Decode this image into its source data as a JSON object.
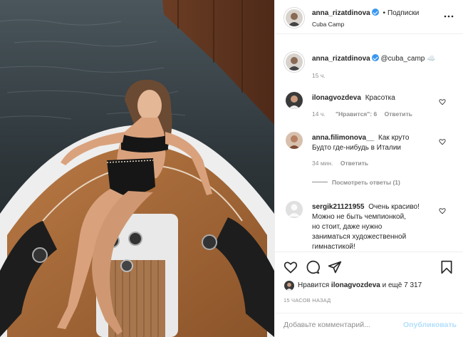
{
  "header": {
    "username": "anna_rizatdinova",
    "separator": "•",
    "follow_label": "Подписки",
    "location": "Cuba Camp",
    "more_icon": "more-horizontal-icon"
  },
  "caption": {
    "username": "anna_rizatdinova",
    "text": "@cuba_camp ☁️",
    "time": "15 ч."
  },
  "comments": [
    {
      "username": "ilonagvozdeva",
      "text": "Красотка",
      "time": "14 ч.",
      "likes": "\"Нравится\": 6",
      "reply": "Ответить"
    },
    {
      "username": "anna.filimonova__",
      "text_line1": "Как круто",
      "text_line2": "Будто где-нибудь в Италии",
      "time": "34 мин.",
      "reply": "Ответить",
      "view_replies": "Посмотреть ответы (1)"
    },
    {
      "username": "sergik21121955",
      "text_line1": "Очень красиво!",
      "text_line2": "Можно не быть чемпионкой,",
      "text_line3": "но стоит, даже нужно",
      "text_line4": "заниматься художественной",
      "text_line5": "гимнастикой!"
    }
  ],
  "likes": {
    "prefix": "Нравится",
    "user": "ilonagvozdeva",
    "suffix": "и ещё 7 317"
  },
  "timestamp": "15 ЧАСОВ НАЗАД",
  "add_comment": {
    "placeholder": "Добавьте комментарий...",
    "publish_label": "Опубликовать"
  },
  "icons": [
    "heart-icon",
    "comment-icon",
    "share-icon",
    "bookmark-icon"
  ],
  "colors": {
    "verified": "#3897f0",
    "publish_disabled": "#b2dffc",
    "muted": "#8e8e8e"
  }
}
